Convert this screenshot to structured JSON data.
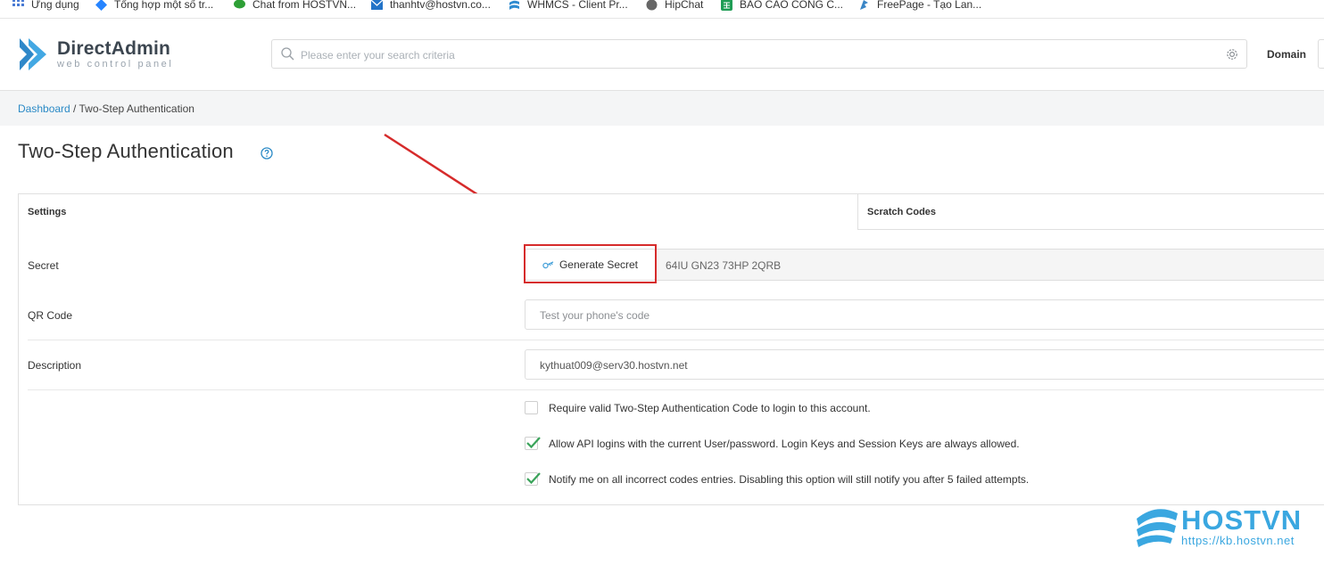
{
  "bookmarks": [
    {
      "label": "Ứng dụng",
      "icon": "apps-grid-icon",
      "color": "#4a7bd4"
    },
    {
      "label": "Tổng hợp một số tr...",
      "icon": "jira-icon",
      "color": "#2684ff"
    },
    {
      "label": "Chat from HOSTVN...",
      "icon": "chat-bubble-icon",
      "color": "#2e9f36"
    },
    {
      "label": "thanhtv@hostvn.co...",
      "icon": "mail-icon",
      "color": "#2273c8"
    },
    {
      "label": "WHMCS - Client Pr...",
      "icon": "whmcs-icon",
      "color": "#2f8bd0"
    },
    {
      "label": "HipChat",
      "icon": "hipchat-icon",
      "color": "#666666"
    },
    {
      "label": "BÁO CÁO CÔNG C...",
      "icon": "sheets-icon",
      "color": "#1f9d55"
    },
    {
      "label": "FreePage - Tạo Lan...",
      "icon": "freepage-icon",
      "color": "#3b86c6"
    }
  ],
  "header": {
    "logo_title": "DirectAdmin",
    "logo_subtitle": "web control panel",
    "search_placeholder": "Please enter your search criteria",
    "domain_label": "Domain"
  },
  "breadcrumb": {
    "home": "Dashboard",
    "separator": " / ",
    "current": "Two-Step Authentication"
  },
  "page": {
    "title": "Two-Step Authentication"
  },
  "panel": {
    "tabs": [
      {
        "label": "Settings",
        "active": true
      },
      {
        "label": "Scratch Codes",
        "active": false
      }
    ],
    "rows": {
      "secret_label": "Secret",
      "generate_button": "Generate Secret",
      "secret_value": "64IU GN23 73HP 2QRB",
      "qr_label": "QR Code",
      "qr_placeholder": "Test your phone's code",
      "description_label": "Description",
      "description_value": "kythuat009@serv30.hostvn.net"
    },
    "options": [
      {
        "label": "Require valid Two-Step Authentication Code to login to this account.",
        "checked": false
      },
      {
        "label": "Allow API logins with the current User/password. Login Keys and Session Keys are always allowed.",
        "checked": true
      },
      {
        "label": "Notify me on all incorrect codes entries. Disabling this option will still notify you after 5 failed attempts.",
        "checked": true
      }
    ]
  },
  "watermark": {
    "brand": "HOSTVN",
    "url": "https://kb.hostvn.net"
  },
  "colors": {
    "accent": "#2b8ac6",
    "annotation": "#d62b2b",
    "check": "#3aa35a",
    "watermark": "#3aa7e0"
  }
}
